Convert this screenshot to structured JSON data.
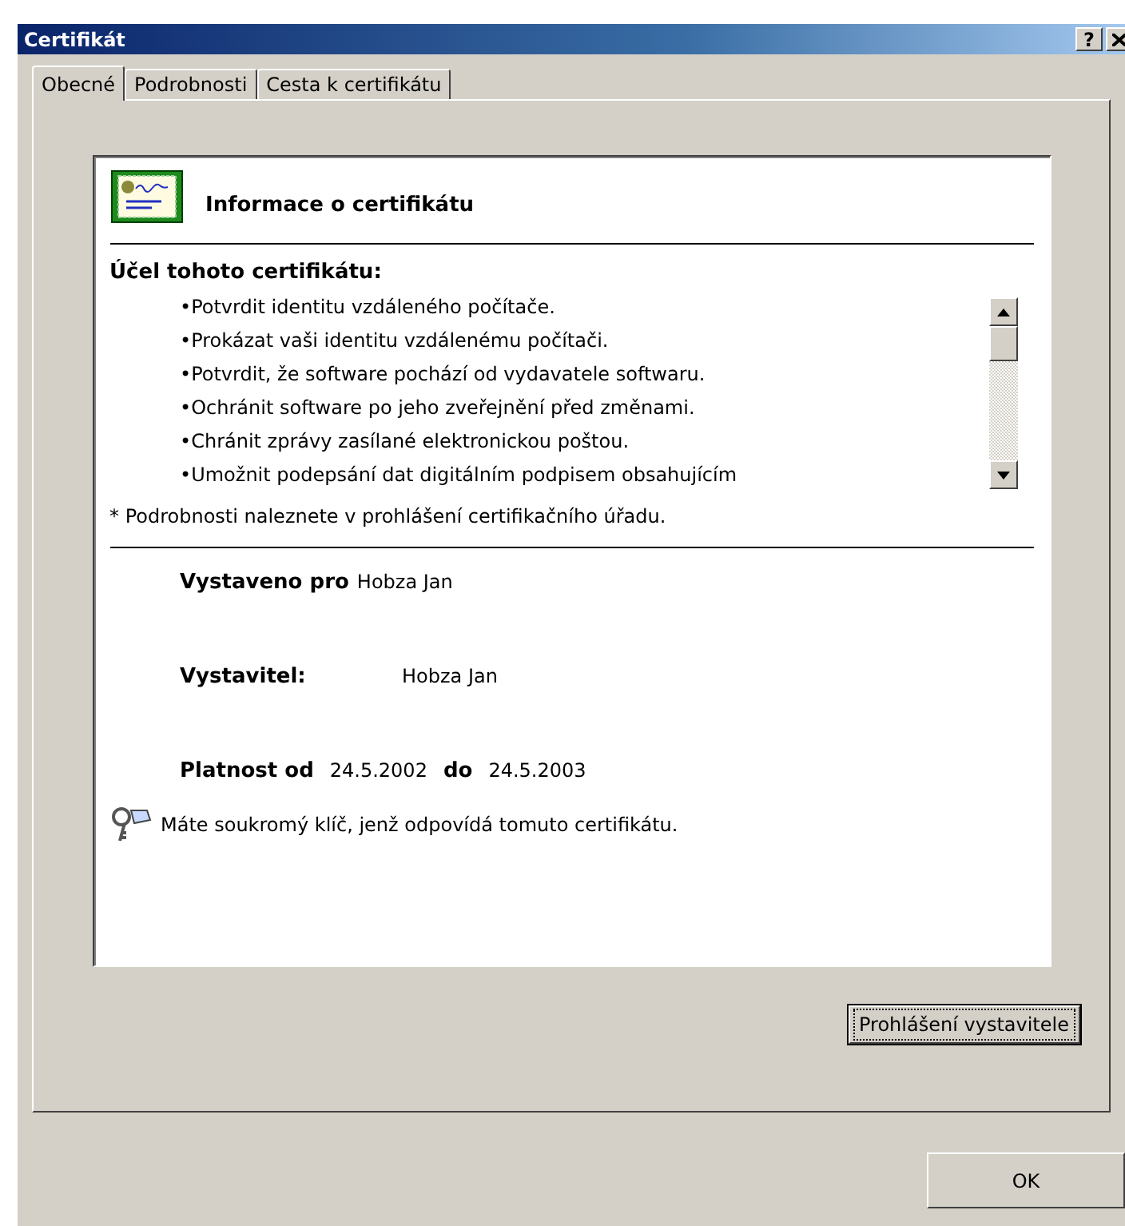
{
  "window": {
    "title": "Certifikát",
    "help": "?"
  },
  "tabs": [
    {
      "label": "Obecné",
      "selected": true
    },
    {
      "label": "Podrobnosti",
      "selected": false
    },
    {
      "label": "Cesta k certifikátu",
      "selected": false
    }
  ],
  "info": {
    "heading": "Informace o certifikátu",
    "purpose_title": "Účel tohoto certifikátu:",
    "purposes": [
      "•Potvrdit identitu vzdáleného počítače.",
      "•Prokázat vaši identitu vzdálenému počítači.",
      "•Potvrdit, že software pochází od vydavatele softwaru.",
      "•Ochránit software po jeho zveřejnění před změnami.",
      "•Chránit zprávy zasílané elektronickou poštou.",
      "•Umožnit podepsání dat digitálním podpisem obsahujícím"
    ],
    "note": "* Podrobnosti naleznete v prohlášení certifikačního úřadu.",
    "issued_to": {
      "label": "Vystaveno pro",
      "value": "Hobza Jan"
    },
    "issuer": {
      "label": "Vystavitel:",
      "value": "Hobza Jan"
    },
    "validity": {
      "from_label": "Platnost od",
      "from": "24.5.2002",
      "to_label": "do",
      "to": "24.5.2003"
    },
    "private_key": "Máte soukromý klíč, jenž odpovídá tomuto certifikátu."
  },
  "statement_button": {
    "label": "Prohlášení vystavitele",
    "focused": true
  },
  "ok_button": {
    "label": "OK"
  }
}
